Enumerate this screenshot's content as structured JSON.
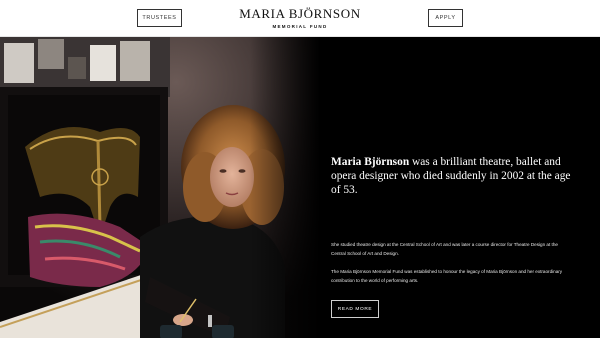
{
  "header": {
    "left_button": "TRUSTEES",
    "right_button": "APPLY",
    "brand_name": "MARIA BJÖRNSON",
    "brand_sub": "MEMORIAL FUND"
  },
  "hero": {
    "lead_name": "Maria Björnson",
    "lead_rest": " was a brilliant theatre, ballet and opera designer who died suddenly in 2002 at the age of 53.",
    "paragraph_1": "She studied theatre design at the Central School of Art and was later a course director for Theatre Design at the Central School of Art and Design.",
    "paragraph_2": "The Maria Björnson Memorial Fund was established to honour the legacy of Maria Björnson and her extraordinary contribution to the world of performing arts.",
    "read_more": "READ MORE"
  },
  "colors": {
    "header_bg": "#ffffff",
    "hero_bg": "#000000",
    "text_light": "#ffffff"
  }
}
